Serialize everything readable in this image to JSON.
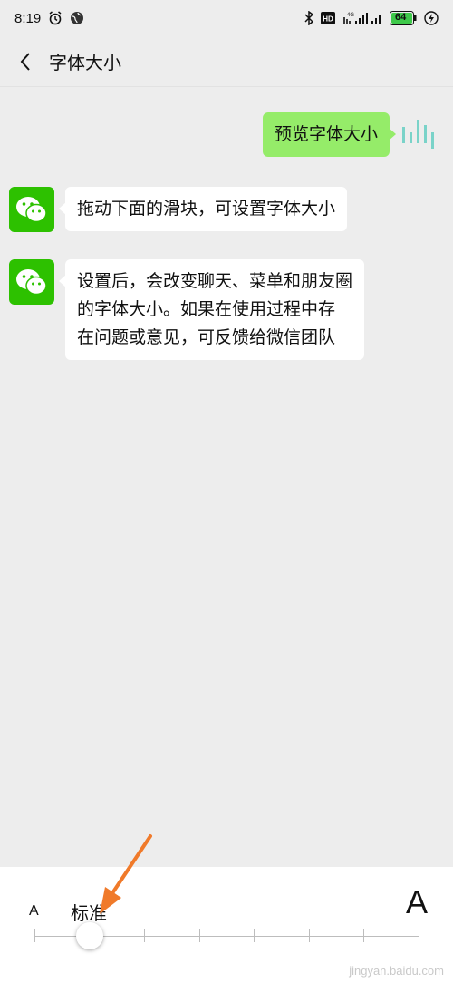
{
  "status_bar": {
    "time": "8:19",
    "battery": "64",
    "network": "4G"
  },
  "header": {
    "title": "字体大小"
  },
  "messages": {
    "preview": "预览字体大小",
    "tip1": "拖动下面的滑块，可设置字体大小",
    "tip2": [
      "设置后，会改变聊天、菜单和朋友圈",
      "的字体大小。如果在使用过程中存",
      "在问题或意见，可反馈给微信团队"
    ]
  },
  "font_size": {
    "small_label": "A",
    "current_label": "标准",
    "large_label": "A",
    "levels": 8,
    "selected_level": 2
  },
  "watermark": "jingyan.baidu.com",
  "colors": {
    "accent": "#95ec69",
    "wechat_green": "#2dc100",
    "arrow": "#f07a2a"
  }
}
